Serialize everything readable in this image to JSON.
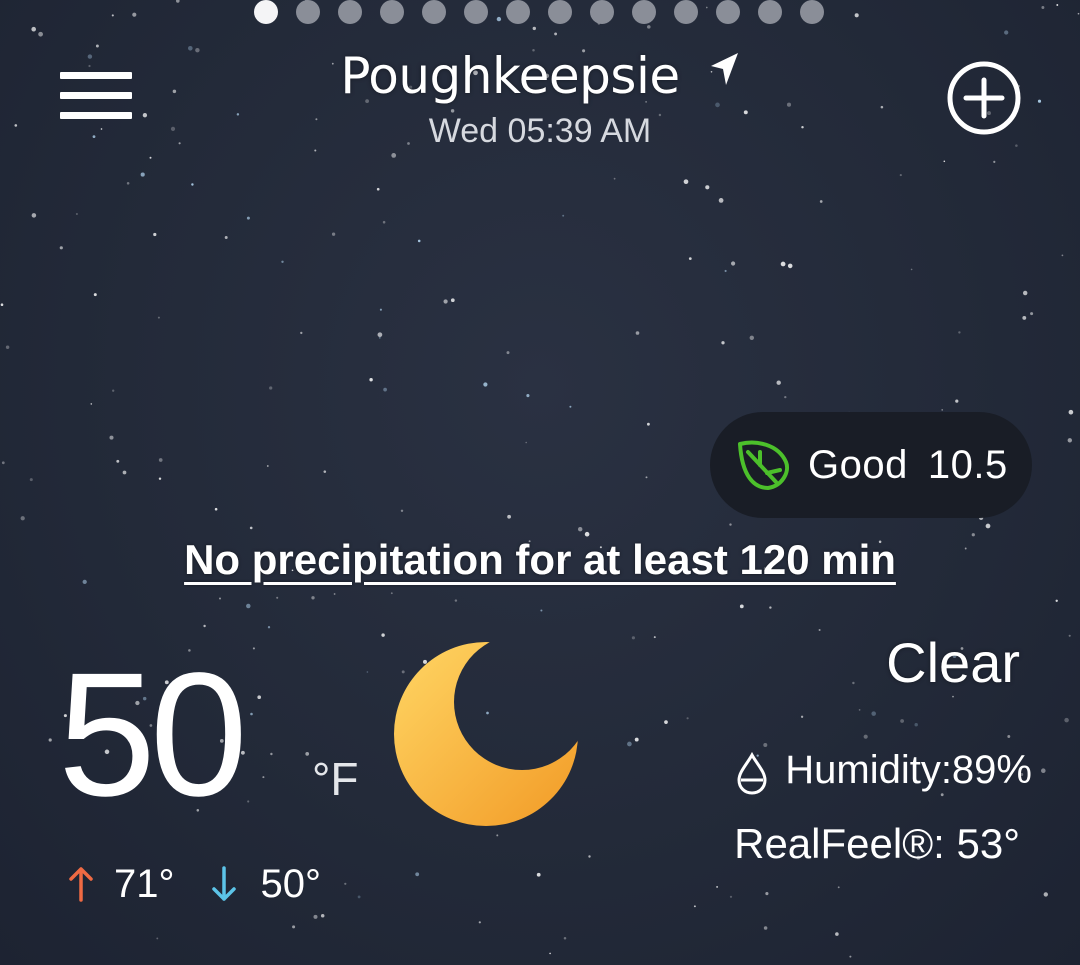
{
  "header": {
    "page_indicator": {
      "count": 14,
      "active_index": 0
    },
    "city": "Poughkeepsie",
    "date_time": "Wed 05:39 AM",
    "icons": {
      "menu": "hamburger-menu-icon",
      "location": "location-arrow-icon",
      "add": "add-location-icon"
    }
  },
  "air_quality": {
    "label": "Good",
    "value": "10.5",
    "icon": "leaf-icon",
    "icon_color": "#4cc02b"
  },
  "precipitation": {
    "text": "No precipitation for at least 120 min"
  },
  "current": {
    "temperature": "50",
    "unit": "°F",
    "icon": "moon-icon",
    "condition": "Clear",
    "high": "71°",
    "low": "50°",
    "humidity": "Humidity:89%",
    "realfeel": "RealFeel®: 53°"
  },
  "colors": {
    "background": "#232a39",
    "aqi_pill": "#191d26",
    "high_arrow": "#ef6a43",
    "low_arrow": "#5cc4e8",
    "moon_light": "#ffd060",
    "moon_dark": "#f3a22c"
  }
}
